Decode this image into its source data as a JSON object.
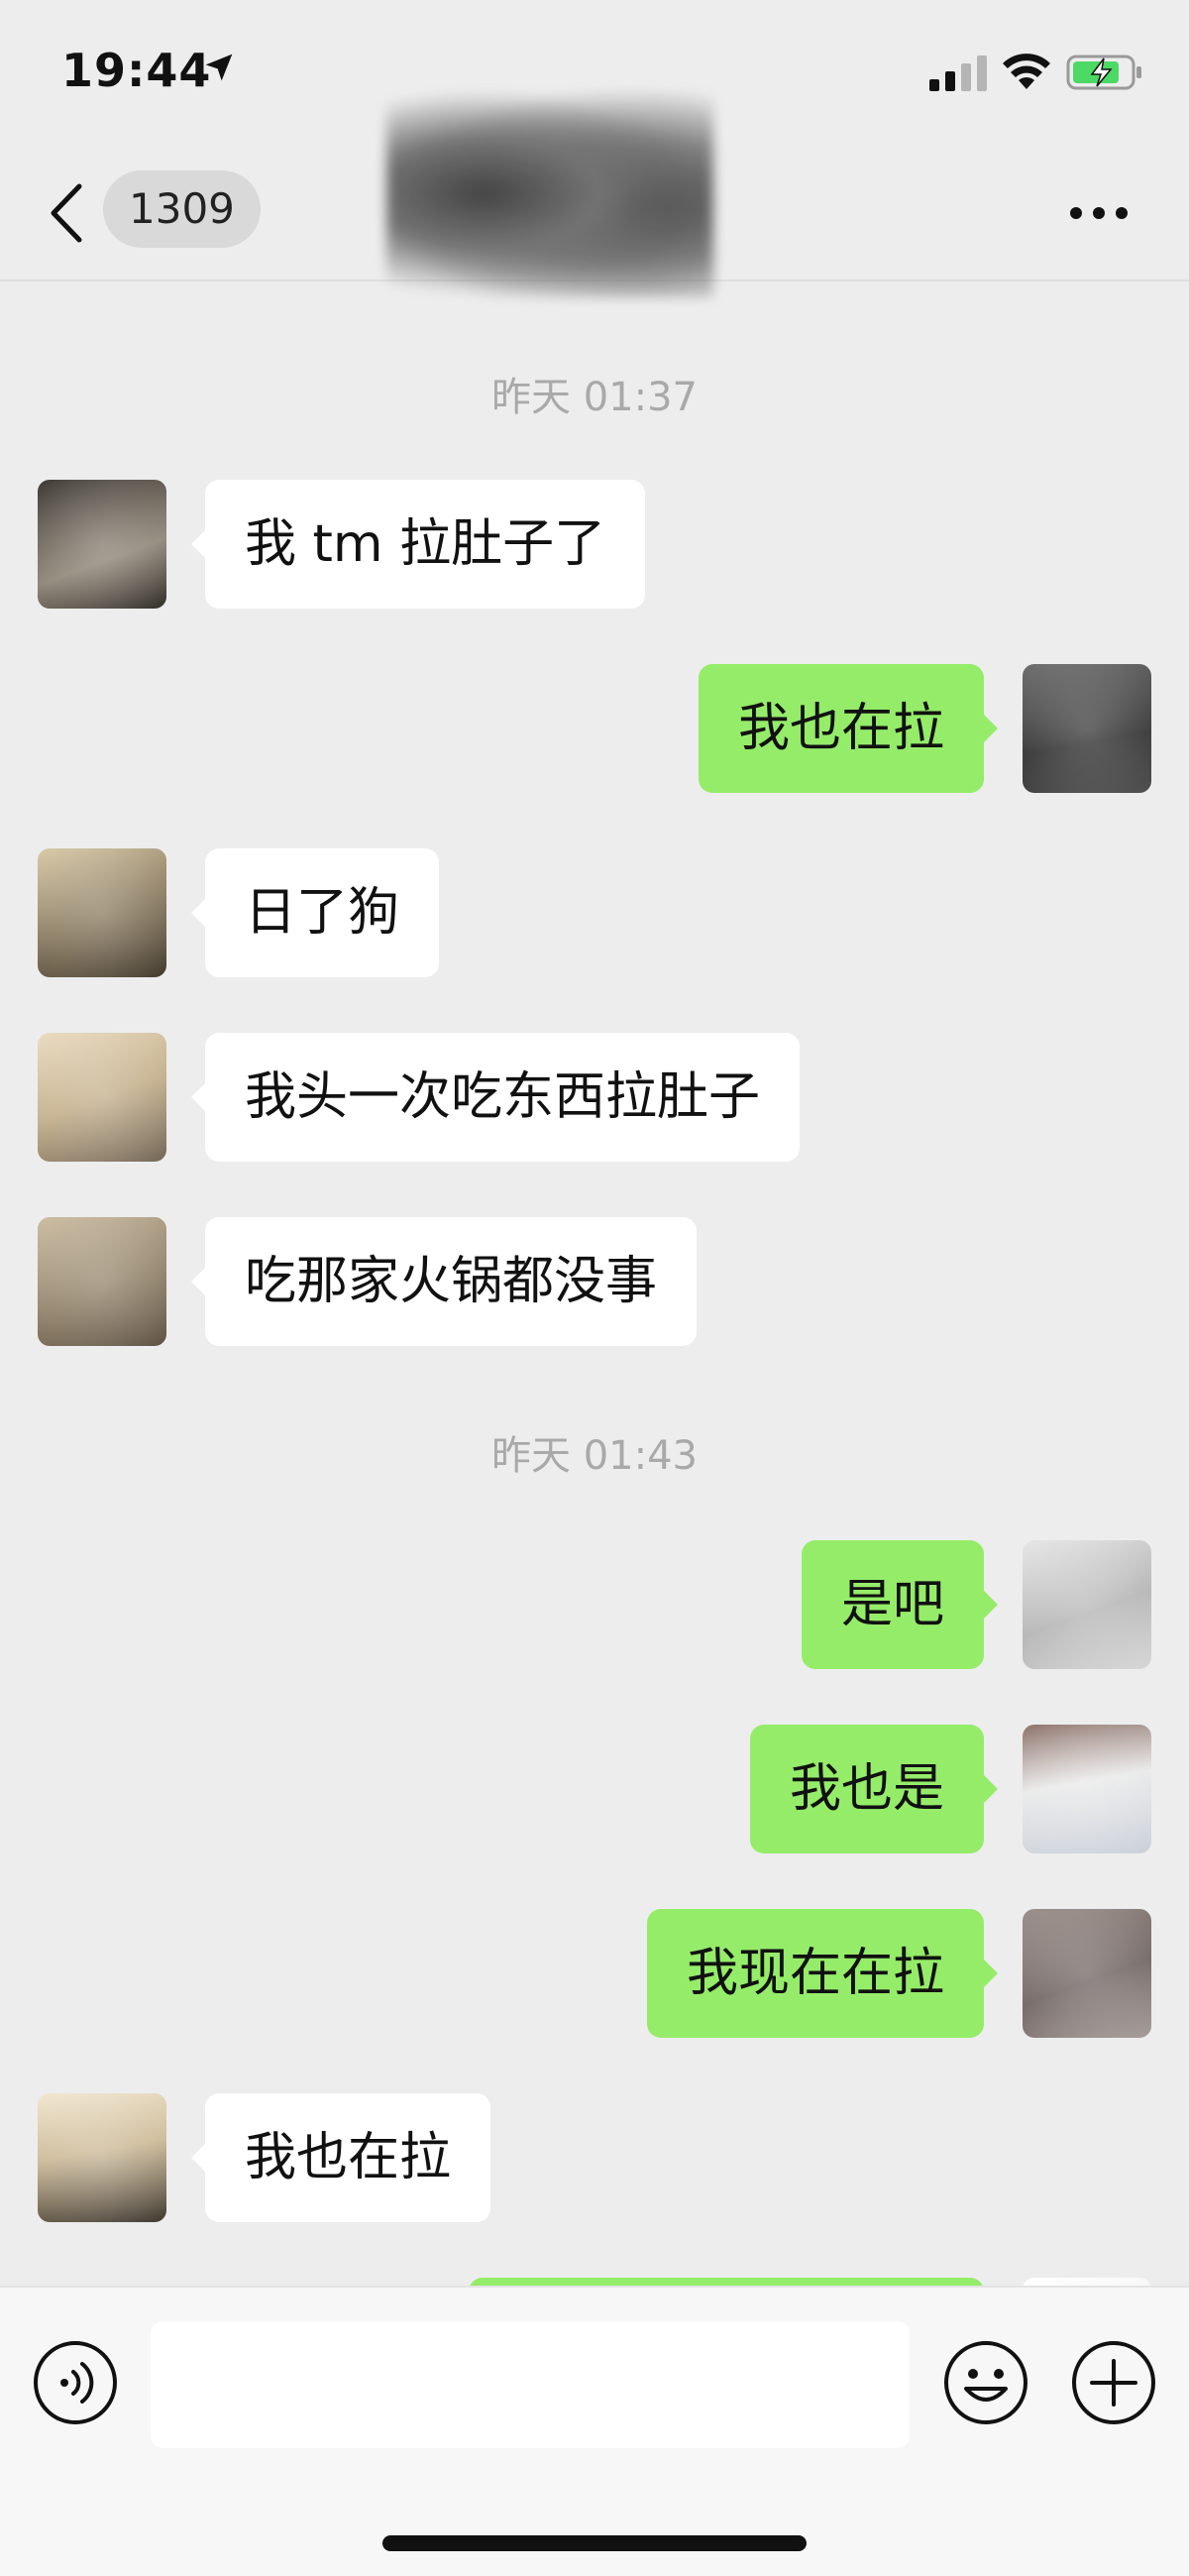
{
  "status_bar": {
    "time": "19:44",
    "icons": [
      "location-arrow-icon",
      "cellular-signal-icon",
      "wifi-icon",
      "battery-charging-icon"
    ],
    "battery_color": "#4cd964"
  },
  "nav": {
    "back_icon": "chevron-left-icon",
    "unread_count": "1309",
    "more_icon": "ellipsis-icon"
  },
  "colors": {
    "background": "#ededed",
    "incoming_bubble": "#ffffff",
    "outgoing_bubble": "#95ec69",
    "timestamp_text": "#a9a9a9"
  },
  "chat": {
    "timestamps": [
      "昨天 01:37",
      "昨天 01:43"
    ],
    "messages": [
      {
        "side": "left",
        "text": "我 tm 拉肚子了"
      },
      {
        "side": "right",
        "text": "我也在拉"
      },
      {
        "side": "left",
        "text": "日了狗"
      },
      {
        "side": "left",
        "text": "我头一次吃东西拉肚子"
      },
      {
        "side": "left",
        "text": "吃那家火锅都没事"
      },
      {
        "side": "right",
        "text": "是吧"
      },
      {
        "side": "right",
        "text": "我也是"
      },
      {
        "side": "right",
        "text": "我现在在拉"
      },
      {
        "side": "left",
        "text": "我也在拉"
      },
      {
        "side": "right",
        "text": ""
      }
    ]
  },
  "input_bar": {
    "voice_icon": "voice-input-icon",
    "text_value": "",
    "emoji_icon": "emoji-smile-icon",
    "plus_icon": "plus-circle-icon"
  }
}
